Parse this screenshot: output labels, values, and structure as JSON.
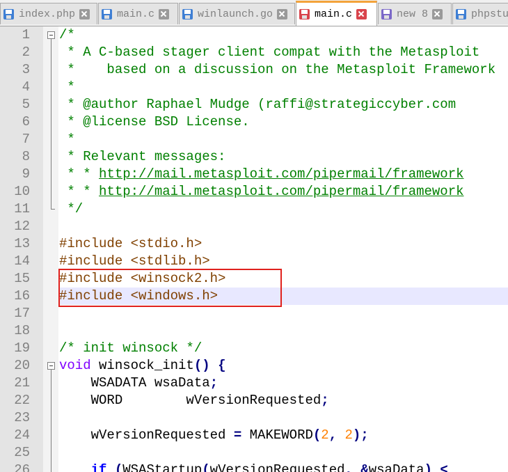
{
  "tabs": [
    {
      "label": "index.php",
      "icon": "file-disk-icon",
      "color": "#3f7fd4",
      "active": false
    },
    {
      "label": "main.c",
      "icon": "file-disk-icon",
      "color": "#3f7fd4",
      "active": false
    },
    {
      "label": "winlaunch.go",
      "icon": "file-disk-icon",
      "color": "#3f7fd4",
      "active": false
    },
    {
      "label": "main.c",
      "icon": "file-disk-icon",
      "color": "#d9434b",
      "active": true
    },
    {
      "label": "new 8",
      "icon": "file-disk-icon",
      "color": "#7b68c8",
      "active": false
    },
    {
      "label": "phpstu",
      "icon": "file-disk-icon",
      "color": "#3f7fd4",
      "active": false
    }
  ],
  "editor": {
    "current_line": 16,
    "highlight_lines": [
      15,
      16
    ],
    "lines": [
      {
        "n": "1",
        "fold": "open",
        "tokens": [
          [
            "c-comment",
            "/*"
          ]
        ]
      },
      {
        "n": "2",
        "fold": "bar",
        "tokens": [
          [
            "c-comment",
            " * A C-based stager client compat with the Metasploit"
          ]
        ]
      },
      {
        "n": "3",
        "fold": "bar",
        "tokens": [
          [
            "c-comment",
            " *    based on a discussion on the Metasploit Framework"
          ]
        ]
      },
      {
        "n": "4",
        "fold": "bar",
        "tokens": [
          [
            "c-comment",
            " *"
          ]
        ]
      },
      {
        "n": "5",
        "fold": "bar",
        "tokens": [
          [
            "c-comment",
            " * @author Raphael Mudge (raffi@strategiccyber.com"
          ]
        ]
      },
      {
        "n": "6",
        "fold": "bar",
        "tokens": [
          [
            "c-comment",
            " * @license BSD License."
          ]
        ]
      },
      {
        "n": "7",
        "fold": "bar",
        "tokens": [
          [
            "c-comment",
            " *"
          ]
        ]
      },
      {
        "n": "8",
        "fold": "bar",
        "tokens": [
          [
            "c-comment",
            " * Relevant messages:"
          ]
        ]
      },
      {
        "n": "9",
        "fold": "bar",
        "tokens": [
          [
            "c-comment",
            " * * "
          ],
          [
            "c-link",
            "http://mail.metasploit.com/pipermail/framework"
          ]
        ]
      },
      {
        "n": "10",
        "fold": "bar",
        "tokens": [
          [
            "c-comment",
            " * * "
          ],
          [
            "c-link",
            "http://mail.metasploit.com/pipermail/framework"
          ]
        ]
      },
      {
        "n": "11",
        "fold": "end",
        "tokens": [
          [
            "c-comment",
            " */"
          ]
        ]
      },
      {
        "n": "12",
        "fold": "",
        "tokens": []
      },
      {
        "n": "13",
        "fold": "",
        "tokens": [
          [
            "c-pre",
            "#include <stdio.h>"
          ]
        ]
      },
      {
        "n": "14",
        "fold": "",
        "tokens": [
          [
            "c-pre",
            "#include <stdlib.h>"
          ]
        ]
      },
      {
        "n": "15",
        "fold": "",
        "tokens": [
          [
            "c-pre",
            "#include <winsock2.h>"
          ]
        ]
      },
      {
        "n": "16",
        "fold": "",
        "tokens": [
          [
            "c-pre",
            "#include <windows.h>"
          ]
        ]
      },
      {
        "n": "17",
        "fold": "",
        "tokens": []
      },
      {
        "n": "18",
        "fold": "",
        "tokens": []
      },
      {
        "n": "19",
        "fold": "",
        "tokens": [
          [
            "c-comment",
            "/* init winsock */"
          ]
        ]
      },
      {
        "n": "20",
        "fold": "open",
        "tokens": [
          [
            "c-type",
            "void"
          ],
          [
            "c-plain",
            " winsock_init"
          ],
          [
            "c-op",
            "()"
          ],
          [
            "c-plain",
            " "
          ],
          [
            "c-op",
            "{"
          ]
        ]
      },
      {
        "n": "21",
        "fold": "bar",
        "tokens": [
          [
            "c-plain",
            "    WSADATA wsaData"
          ],
          [
            "c-op",
            ";"
          ]
        ]
      },
      {
        "n": "22",
        "fold": "bar",
        "tokens": [
          [
            "c-plain",
            "    WORD        wVersionRequested"
          ],
          [
            "c-op",
            ";"
          ]
        ]
      },
      {
        "n": "23",
        "fold": "bar",
        "tokens": []
      },
      {
        "n": "24",
        "fold": "bar",
        "tokens": [
          [
            "c-plain",
            "    wVersionRequested "
          ],
          [
            "c-op",
            "="
          ],
          [
            "c-plain",
            " MAKEWORD"
          ],
          [
            "c-op",
            "("
          ],
          [
            "c-num",
            "2"
          ],
          [
            "c-op",
            ","
          ],
          [
            "c-plain",
            " "
          ],
          [
            "c-num",
            "2"
          ],
          [
            "c-op",
            ");"
          ]
        ]
      },
      {
        "n": "25",
        "fold": "bar",
        "tokens": []
      },
      {
        "n": "26",
        "fold": "bar",
        "tokens": [
          [
            "c-plain",
            "    "
          ],
          [
            "c-kw",
            "if"
          ],
          [
            "c-plain",
            " "
          ],
          [
            "c-op",
            "("
          ],
          [
            "c-plain",
            "WSAStartup"
          ],
          [
            "c-op",
            "("
          ],
          [
            "c-plain",
            "wVersionRequested"
          ],
          [
            "c-op",
            ","
          ],
          [
            "c-plain",
            " "
          ],
          [
            "c-op",
            "&"
          ],
          [
            "c-plain",
            "wsaData"
          ],
          [
            "c-op",
            ")"
          ],
          [
            "c-plain",
            " "
          ],
          [
            "c-op",
            "<"
          ]
        ]
      }
    ]
  }
}
